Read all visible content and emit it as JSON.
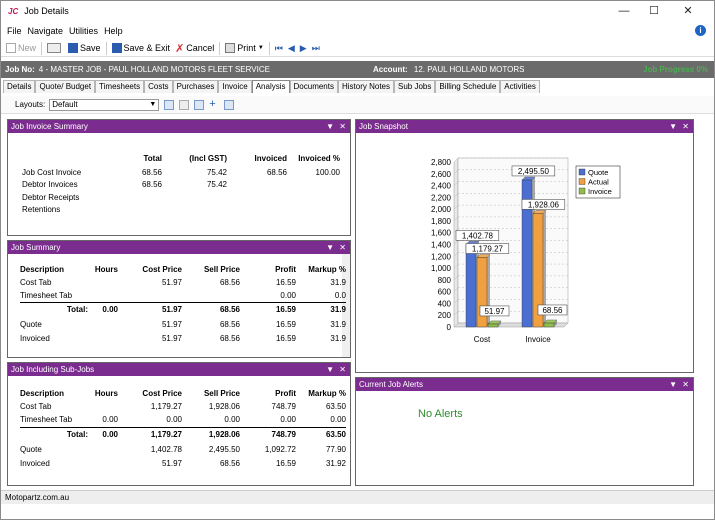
{
  "window": {
    "logo": "JC",
    "title": "Job Details"
  },
  "menu": [
    "File",
    "Navigate",
    "Utilities",
    "Help"
  ],
  "toolbar": {
    "new": "New",
    "save": "Save",
    "save_exit": "Save & Exit",
    "cancel": "Cancel",
    "print": "Print"
  },
  "jobbar": {
    "job_label": "Job No:",
    "job_value": "4 - MASTER JOB - PAUL HOLLAND MOTORS FLEET SERVICE",
    "account_label": "Account:",
    "account_value": "12. PAUL HOLLAND MOTORS",
    "progress": "Job Progress 0%"
  },
  "tabs": [
    "Details",
    "Quote/ Budget",
    "Timesheets",
    "Costs",
    "Purchases",
    "Invoice",
    "Analysis",
    "Documents",
    "History Notes",
    "Sub Jobs",
    "Billing Schedule",
    "Activities"
  ],
  "layouts": {
    "label": "Layouts:",
    "value": "Default"
  },
  "invoice_summary": {
    "title": "Job Invoice Summary",
    "headers": [
      "Total",
      "(Incl GST)",
      "Invoiced",
      "Invoiced %"
    ],
    "rows": [
      [
        "Job Cost Invoice",
        "68.56",
        "75.42",
        "68.56",
        "100.00"
      ],
      [
        "Debtor Invoices",
        "68.56",
        "75.42",
        "",
        ""
      ],
      [
        "Debtor Receipts",
        "",
        "",
        "",
        ""
      ],
      [
        "Retentions",
        "",
        "",
        "",
        ""
      ]
    ]
  },
  "job_summary": {
    "title": "Job Summary",
    "headers": [
      "Description",
      "Hours",
      "Cost Price",
      "Sell Price",
      "Profit",
      "Markup %"
    ],
    "rows": [
      [
        "Cost Tab",
        "",
        "51.97",
        "68.56",
        "16.59",
        "31.9"
      ],
      [
        "Timesheet Tab",
        "",
        "",
        "",
        "0.00",
        "0.0"
      ]
    ],
    "total": [
      "Total:",
      "0.00",
      "51.97",
      "68.56",
      "16.59",
      "31.9"
    ],
    "extra": [
      [
        "Quote",
        "",
        "51.97",
        "68.56",
        "16.59",
        "31.9"
      ],
      [
        "Invoiced",
        "",
        "51.97",
        "68.56",
        "16.59",
        "31.9"
      ]
    ]
  },
  "subjobs": {
    "title": "Job Including Sub-Jobs",
    "headers": [
      "Description",
      "Hours",
      "Cost Price",
      "Sell Price",
      "Profit",
      "Markup %"
    ],
    "rows": [
      [
        "Cost Tab",
        "",
        "1,179.27",
        "1,928.06",
        "748.79",
        "63.50"
      ],
      [
        "Timesheet Tab",
        "0.00",
        "0.00",
        "0.00",
        "0.00",
        "0.00"
      ]
    ],
    "total": [
      "Total:",
      "0.00",
      "1,179.27",
      "1,928.06",
      "748.79",
      "63.50"
    ],
    "extra": [
      [
        "Quote",
        "",
        "1,402.78",
        "2,495.50",
        "1,092.72",
        "77.90"
      ],
      [
        "Invoiced",
        "",
        "51.97",
        "68.56",
        "16.59",
        "31.92"
      ]
    ]
  },
  "snapshot": {
    "title": "Job Snapshot"
  },
  "alerts": {
    "title": "Current Job Alerts",
    "message": "No Alerts"
  },
  "status": {
    "text": "Motopartz.com.au"
  },
  "colors": {
    "quote": "#4a6fd1",
    "actual": "#f0a040",
    "invoice": "#8fbf4a",
    "panel_header": "#7b2d8f"
  },
  "chart_data": {
    "type": "bar",
    "categories": [
      "Cost",
      "Invoice"
    ],
    "series": [
      {
        "name": "Quote",
        "values": [
          1402.78,
          2495.5
        ]
      },
      {
        "name": "Actual",
        "values": [
          1179.27,
          1928.06
        ]
      },
      {
        "name": "Invoice",
        "values": [
          51.97,
          68.56
        ]
      }
    ],
    "ylim": [
      0,
      2800
    ],
    "yticks": [
      "0",
      "200",
      "400",
      "600",
      "800",
      "1,000",
      "1,200",
      "1,400",
      "1,600",
      "1,800",
      "2,000",
      "2,200",
      "2,400",
      "2,600",
      "2,800"
    ],
    "data_labels": [
      [
        "1,402.78",
        "1,179.27",
        "51.97"
      ],
      [
        "2,495.50",
        "1,928.06",
        "68.56"
      ]
    ],
    "legend": "top-right",
    "grid": true
  }
}
